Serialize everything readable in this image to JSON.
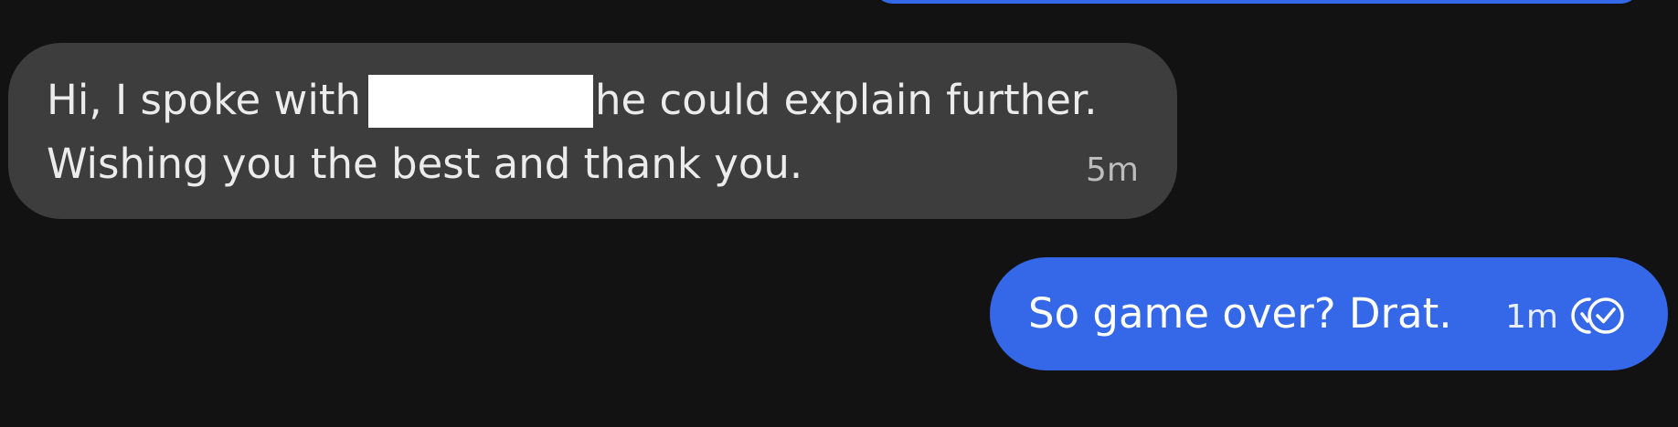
{
  "messages": [
    {
      "direction": "received",
      "line1_before": "Hi, I spoke with ",
      "line1_after": "he could explain further.",
      "line2": "Wishing you the best and thank you.",
      "time": "5m",
      "redacted": true
    },
    {
      "direction": "sent",
      "text": "So game over? Drat.",
      "time": "1m",
      "status_icon": "double-check-read-icon"
    }
  ],
  "colors": {
    "background": "#121212",
    "received_bubble": "#3d3d3d",
    "sent_bubble": "#3468e8",
    "redaction": "#ffffff"
  }
}
